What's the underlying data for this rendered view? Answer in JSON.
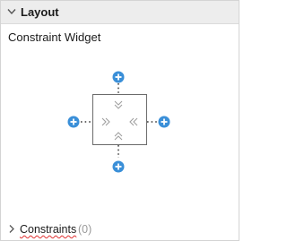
{
  "layout_section": {
    "title": "Layout",
    "expanded": true
  },
  "constraint_widget": {
    "label": "Constraint Widget"
  },
  "constraints_section": {
    "label": "Constraints",
    "count": "(0)",
    "expanded": false
  },
  "colors": {
    "accent": "#3a8fd8",
    "header_bg": "#ededed",
    "border": "#d4d4d4",
    "muted_text": "#9a9a9a",
    "chevron_gray": "#a0a0a0"
  },
  "icons": {
    "add": "plus-circle-icon",
    "expand": "chevron-right-icon",
    "collapse": "chevron-down-icon"
  }
}
